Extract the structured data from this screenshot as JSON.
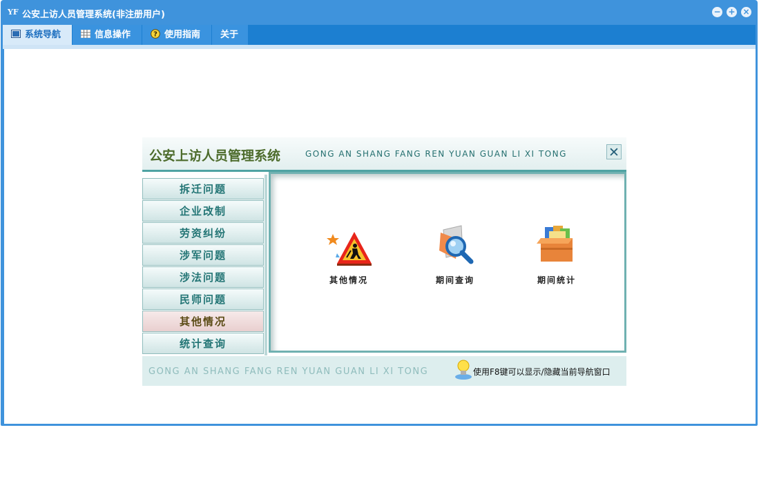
{
  "window": {
    "title": "公安上访人员管理系统(非注册用户)",
    "app_icon": "YF",
    "controls": [
      "minimize-icon",
      "restore-icon",
      "close-icon"
    ]
  },
  "menu": {
    "tabs": [
      {
        "label": "系统导航",
        "icon": "window-icon",
        "active": true
      },
      {
        "label": "信息操作",
        "icon": "grid-icon",
        "active": false
      },
      {
        "label": "使用指南",
        "icon": "help-icon",
        "active": false
      },
      {
        "label": "关于",
        "icon": "",
        "active": false
      }
    ]
  },
  "nav": {
    "title": "公安上访人员管理系统",
    "pinyin": "GONG AN SHANG FANG REN YUAN GUAN LI XI TONG",
    "close_label": "✕",
    "side_items": [
      {
        "label": "拆迁问题",
        "active": false
      },
      {
        "label": "企业改制",
        "active": false
      },
      {
        "label": "劳资纠纷",
        "active": false
      },
      {
        "label": "涉军问题",
        "active": false
      },
      {
        "label": "涉法问题",
        "active": false
      },
      {
        "label": "民师问题",
        "active": false
      },
      {
        "label": "其他情况",
        "active": true
      },
      {
        "label": "统计查询",
        "active": false
      }
    ],
    "tiles": [
      {
        "label": "其他情况",
        "icon": "construction-sign-icon"
      },
      {
        "label": "期间查询",
        "icon": "magnifier-icon"
      },
      {
        "label": "期间统计",
        "icon": "folder-box-icon"
      }
    ],
    "footer_pinyin": "GONG AN SHANG FANG REN YUAN GUAN LI XI TONG",
    "footer_tip": "使用F8键可以显示/隐藏当前导航窗口",
    "colors": {
      "title_bar": "#3f93dc",
      "menu_bar": "#1c7fd1",
      "accent_teal": "#4fa3a3",
      "active_item": "#e9cfcf"
    }
  }
}
